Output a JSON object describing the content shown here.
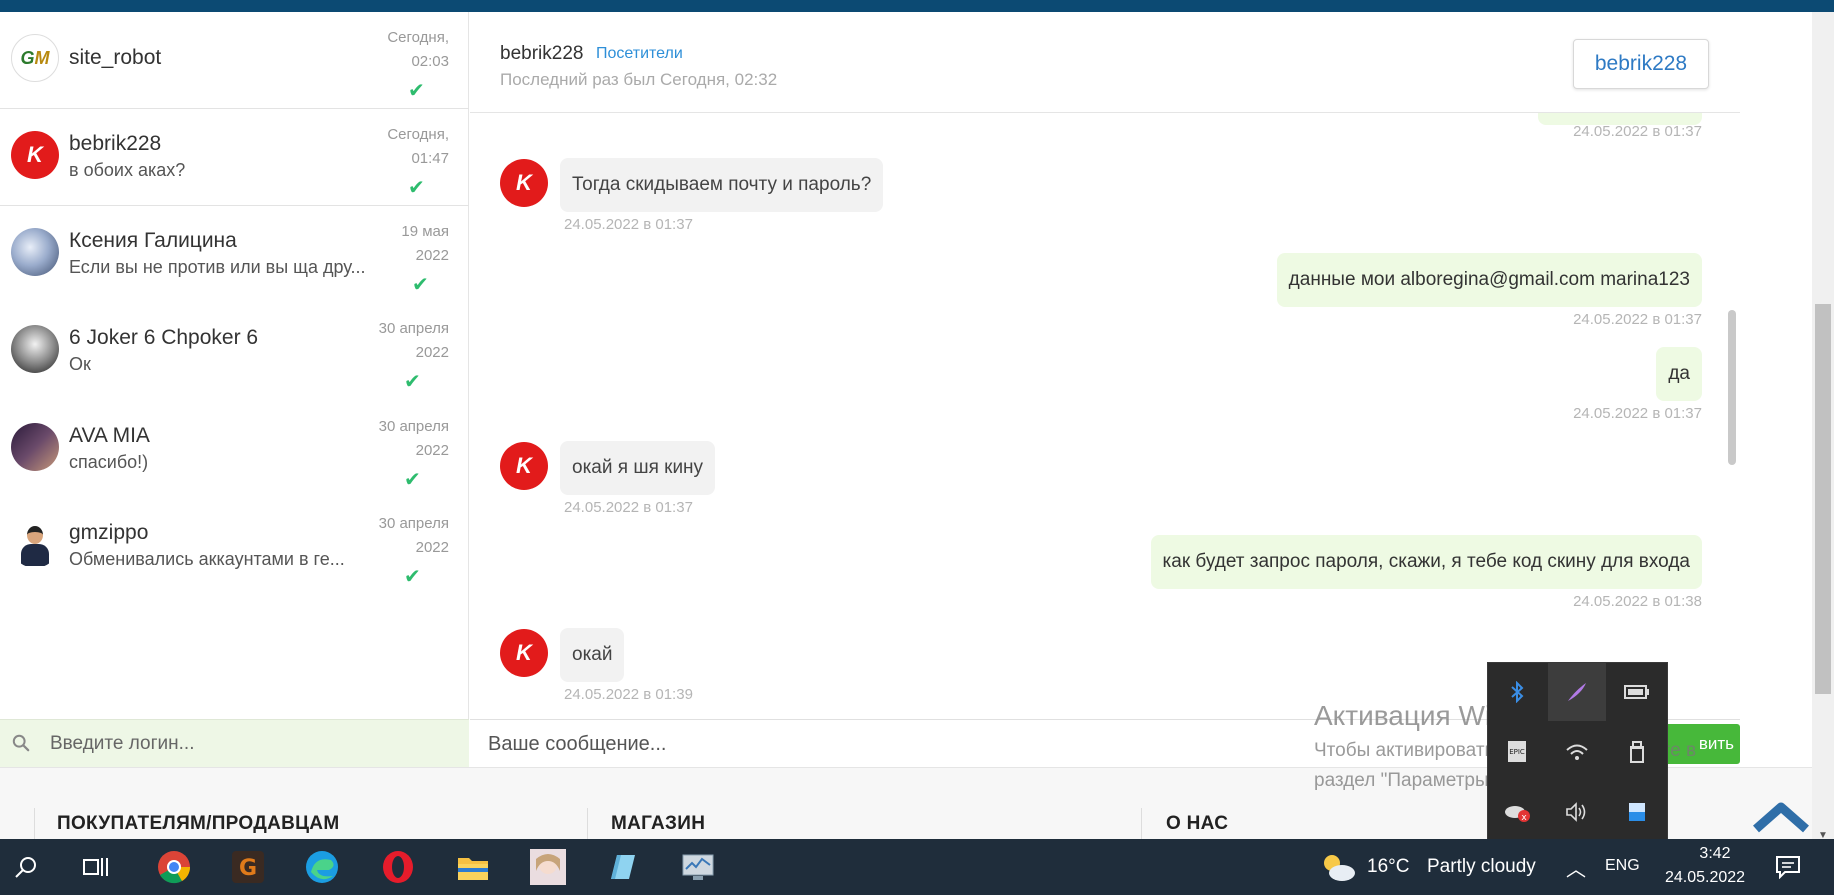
{
  "contacts": [
    {
      "name": "site_robot",
      "last": "",
      "date": "Сегодня,",
      "time": "02:03"
    },
    {
      "name": "bebrik228",
      "last": "в обоих аках?",
      "date": "Сегодня,",
      "time": "01:47"
    },
    {
      "name": "Ксения Галицина",
      "last": "Если вы не против или вы ща дру...",
      "date": "19 мая",
      "time": "2022"
    },
    {
      "name": "6 Joker 6 Chpoker 6",
      "last": "Ок",
      "date": "30 апреля",
      "time": "2022"
    },
    {
      "name": "AVA MIA",
      "last": "спасибо!)",
      "date": "30 апреля",
      "time": "2022"
    },
    {
      "name": "gmzippo",
      "last": "Обменивались аккаунтами в ге...",
      "date": "30 апреля",
      "time": "2022"
    }
  ],
  "check_glyph": "✔",
  "search": {
    "placeholder": "Введите логин..."
  },
  "chat": {
    "name": "bebrik228",
    "role": "Посетители",
    "last_seen": "Последний раз был Сегодня, 02:32",
    "profile_button": "bebrik228"
  },
  "messages": [
    {
      "dir": "out",
      "text": "",
      "time": "24.05.2022 в 01:37"
    },
    {
      "dir": "in",
      "text": "Тогда скидываем почту и пароль?",
      "time": "24.05.2022 в 01:37"
    },
    {
      "dir": "out",
      "text": "данные мои  alboregina@gmail.com marina123",
      "time": "24.05.2022 в 01:37"
    },
    {
      "dir": "out",
      "text": "да",
      "time": "24.05.2022 в 01:37"
    },
    {
      "dir": "in",
      "text": "окай я шя кину",
      "time": "24.05.2022 в 01:37"
    },
    {
      "dir": "out",
      "text": "как будет запрос пароля, скажи, я тебе код скину для входа",
      "time": "24.05.2022 в 01:38"
    },
    {
      "dir": "in",
      "text": "окай",
      "time": "24.05.2022 в 01:39"
    }
  ],
  "compose": {
    "placeholder": "Ваше сообщение...",
    "send_label": "вить"
  },
  "footer": {
    "col1": "ПОКУПАТЕЛЯМ/ПРОДАВЦАМ",
    "col2": "МАГАЗИН",
    "col3": "О НАС"
  },
  "watermark": {
    "title": "Активация Windows",
    "line1": "Чтобы активировать Windows, перейдите в",
    "line2": "раздел \"Параметры\"."
  },
  "taskbar": {
    "weather_temp": "16°C",
    "weather_text": "Partly cloudy",
    "lang": "ENG",
    "time": "3:42",
    "date": "24.05.2022",
    "apps": [
      "search-icon",
      "task-view-icon",
      "chrome-icon",
      "app-g-icon",
      "edge-icon",
      "opera-icon",
      "file-explorer-icon",
      "anime-app-icon",
      "notepad-icon",
      "monitor-app-icon"
    ]
  },
  "colors": {
    "accent_blue": "#2e8fd8",
    "check_green": "#2ebc6e",
    "send_green": "#47b83a",
    "out_bubble": "#eefae3",
    "topbar": "#0c4a73"
  }
}
